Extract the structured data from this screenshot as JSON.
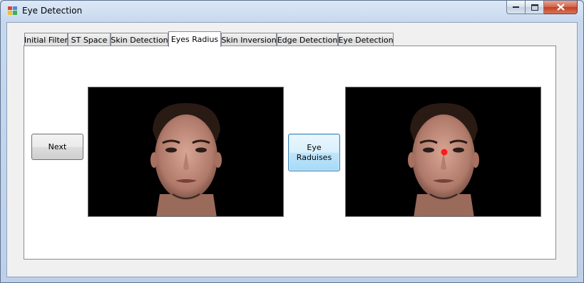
{
  "window": {
    "title": "Eye Detection"
  },
  "tabs": [
    {
      "label": "Initial Filter"
    },
    {
      "label": "ST Space"
    },
    {
      "label": "Skin Detection"
    },
    {
      "label": "Eyes Radius",
      "active": true
    },
    {
      "label": "Skin Inversion"
    },
    {
      "label": "Edge Detection"
    },
    {
      "label": "Eye Detection"
    }
  ],
  "page": {
    "next_button": "Next",
    "eye_radiuses_button": "Eye\nRaduises"
  },
  "colors": {
    "marker": "#ff1a1a",
    "picture_background": "#000000"
  }
}
